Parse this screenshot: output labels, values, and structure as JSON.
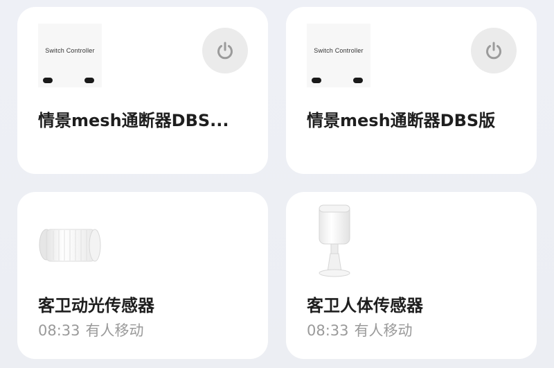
{
  "devices": [
    {
      "name": "情景mesh通断器DBS...",
      "thumb_text": "Switch Controller",
      "icon": "switch-controller",
      "power_icon": "power-icon"
    },
    {
      "name": "情景mesh通断器DBS版",
      "thumb_text": "Switch Controller",
      "icon": "switch-controller",
      "power_icon": "power-icon"
    },
    {
      "name": "客卫动光传感器",
      "icon": "light-sensor",
      "status_time": "08:33",
      "status_text": "有人移动"
    },
    {
      "name": "客卫人体传感器",
      "icon": "motion-sensor",
      "status_time": "08:33",
      "status_text": "有人移动"
    }
  ],
  "colors": {
    "background": "#eceef3",
    "card": "#ffffff",
    "title": "#1e1e1e",
    "status": "#9a9a9a",
    "power_button_bg": "#ebebeb",
    "power_icon": "#9b9b9b"
  }
}
